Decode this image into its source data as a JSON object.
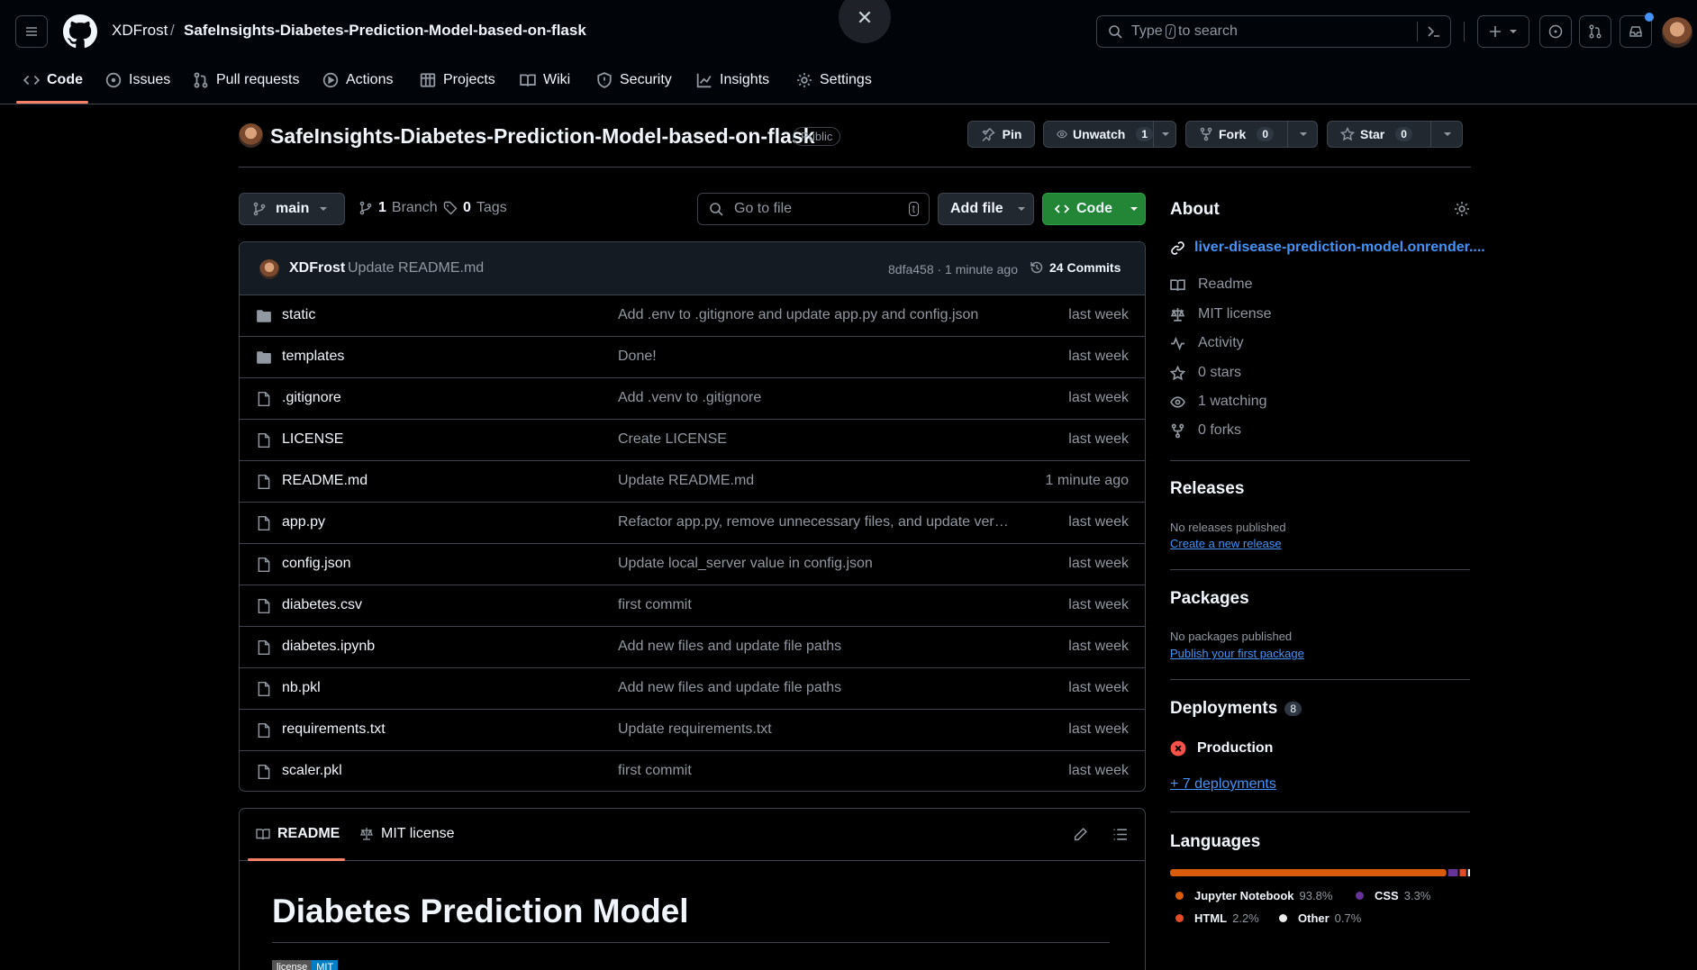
{
  "header": {
    "owner": "XDFrost",
    "separator": "/",
    "repo": "SafeInsights-Diabetes-Prediction-Model-based-on-flask",
    "search_prefix": "Type",
    "search_key": "/",
    "search_suffix": "to search"
  },
  "nav": [
    {
      "label": "Code",
      "icon": "code-icon"
    },
    {
      "label": "Issues",
      "icon": "issue-icon"
    },
    {
      "label": "Pull requests",
      "icon": "pull-request-icon"
    },
    {
      "label": "Actions",
      "icon": "play-icon"
    },
    {
      "label": "Projects",
      "icon": "table-icon"
    },
    {
      "label": "Wiki",
      "icon": "book-icon"
    },
    {
      "label": "Security",
      "icon": "shield-icon"
    },
    {
      "label": "Insights",
      "icon": "graph-icon"
    },
    {
      "label": "Settings",
      "icon": "gear-icon"
    }
  ],
  "repo": {
    "title": "SafeInsights-Diabetes-Prediction-Model-based-on-flask",
    "visibility": "Public",
    "pin_label": "Pin",
    "unwatch_label": "Unwatch",
    "unwatch_count": "1",
    "fork_label": "Fork",
    "fork_count": "0",
    "star_label": "Star",
    "star_count": "0"
  },
  "toolbar": {
    "branch": "main",
    "branches_count": "1",
    "branches_label": "Branch",
    "tags_count": "0",
    "tags_label": "Tags",
    "goto_placeholder": "Go to file",
    "goto_key": "t",
    "add_file_label": "Add file",
    "code_label": "Code"
  },
  "latest_commit": {
    "author": "XDFrost",
    "message": "Update README.md",
    "hash_time": "8dfa458 · 1 minute ago",
    "commits_label": "24 Commits"
  },
  "files": [
    {
      "name": "static",
      "type": "folder",
      "message": "Add .env to .gitignore and update app.py and config.json",
      "time": "last week"
    },
    {
      "name": "templates",
      "type": "folder",
      "message": "Done!",
      "time": "last week"
    },
    {
      "name": ".gitignore",
      "type": "file",
      "message": "Add .venv to .gitignore",
      "time": "last week"
    },
    {
      "name": "LICENSE",
      "type": "file",
      "message": "Create LICENSE",
      "time": "last week"
    },
    {
      "name": "README.md",
      "type": "file",
      "message": "Update README.md",
      "time": "1 minute ago"
    },
    {
      "name": "app.py",
      "type": "file",
      "message": "Refactor app.py, remove unnecessary files, and update verce…",
      "time": "last week"
    },
    {
      "name": "config.json",
      "type": "file",
      "message": "Update local_server value in config.json",
      "time": "last week"
    },
    {
      "name": "diabetes.csv",
      "type": "file",
      "message": "first commit",
      "time": "last week"
    },
    {
      "name": "diabetes.ipynb",
      "type": "file",
      "message": "Add new files and update file paths",
      "time": "last week"
    },
    {
      "name": "nb.pkl",
      "type": "file",
      "message": "Add new files and update file paths",
      "time": "last week"
    },
    {
      "name": "requirements.txt",
      "type": "file",
      "message": "Update requirements.txt",
      "time": "last week"
    },
    {
      "name": "scaler.pkl",
      "type": "file",
      "message": "first commit",
      "time": "last week"
    }
  ],
  "readme": {
    "tab_readme": "README",
    "tab_license": "MIT license",
    "heading": "Diabetes Prediction Model",
    "badge_left": "license",
    "badge_right": "MIT"
  },
  "about": {
    "title": "About",
    "website": "liver-disease-prediction-model.onrender....",
    "items": [
      {
        "label": "Readme",
        "icon": "book-icon"
      },
      {
        "label": "MIT license",
        "icon": "law-icon"
      },
      {
        "label": "Activity",
        "icon": "pulse-icon"
      },
      {
        "label": "0 stars",
        "icon": "star-icon"
      },
      {
        "label": "1 watching",
        "icon": "eye-icon"
      },
      {
        "label": "0 forks",
        "icon": "fork-icon"
      }
    ]
  },
  "releases": {
    "title": "Releases",
    "empty": "No releases published",
    "link": "Create a new release"
  },
  "packages": {
    "title": "Packages",
    "empty": "No packages published",
    "link": "Publish your first package"
  },
  "deployments": {
    "title": "Deployments",
    "count": "8",
    "production": "Production",
    "more": "+ 7 deployments"
  },
  "languages": {
    "title": "Languages",
    "items": [
      {
        "name": "Jupyter Notebook",
        "pct": "93.8%",
        "value": 93.8,
        "color": "#DA5B0B"
      },
      {
        "name": "CSS",
        "pct": "3.3%",
        "value": 3.3,
        "color": "#663399"
      },
      {
        "name": "HTML",
        "pct": "2.2%",
        "value": 2.2,
        "color": "#e34c26"
      },
      {
        "name": "Other",
        "pct": "0.7%",
        "value": 0.7,
        "color": "#ededed"
      }
    ]
  },
  "colors": {
    "accent": "#f78166",
    "link": "#4493f8",
    "success": "#238636",
    "danger": "#f85149"
  }
}
